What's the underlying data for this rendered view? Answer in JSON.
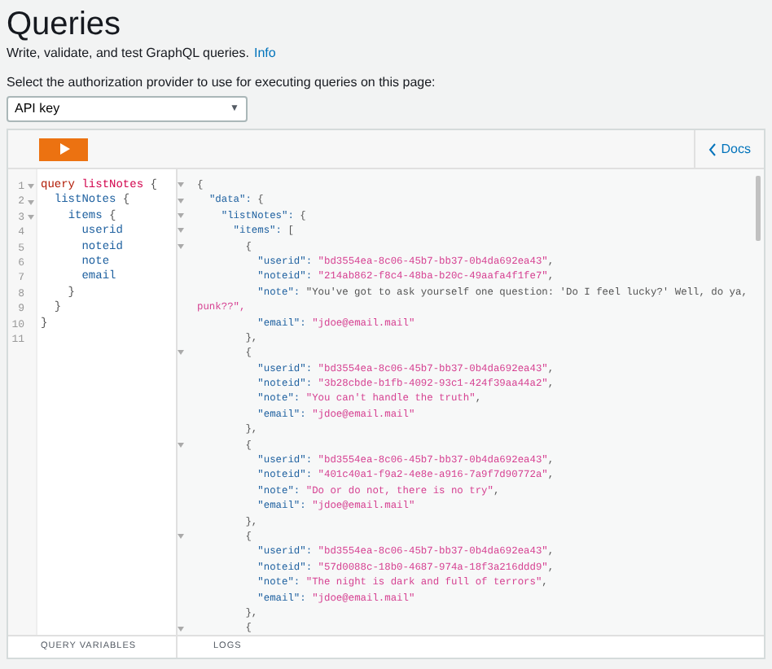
{
  "header": {
    "title": "Queries",
    "subtitle": "Write, validate, and test GraphQL queries.",
    "info_link": "Info",
    "auth_label": "Select the authorization provider to use for executing queries on this page:",
    "auth_select": {
      "value": "API key",
      "caret": "▼"
    }
  },
  "toolbar": {
    "docs": "Docs"
  },
  "query_editor": {
    "lines": [
      {
        "number": "1",
        "foldable": true,
        "text": "query listNotes {"
      },
      {
        "number": "2",
        "foldable": true,
        "text": "  listNotes {"
      },
      {
        "number": "3",
        "foldable": true,
        "text": "    items {"
      },
      {
        "number": "4",
        "foldable": false,
        "text": "      userid"
      },
      {
        "number": "5",
        "foldable": false,
        "text": "      noteid"
      },
      {
        "number": "6",
        "foldable": false,
        "text": "      note"
      },
      {
        "number": "7",
        "foldable": false,
        "text": "      email"
      },
      {
        "number": "8",
        "foldable": false,
        "text": "    }"
      },
      {
        "number": "9",
        "foldable": false,
        "text": "  }"
      },
      {
        "number": "10",
        "foldable": false,
        "text": "}"
      },
      {
        "number": "11",
        "foldable": false
      }
    ]
  },
  "results": {
    "lines": [
      {
        "foldable": true,
        "text": "{"
      },
      {
        "foldable": true,
        "text": "  \"data\": {"
      },
      {
        "foldable": true,
        "text": "    \"listNotes\": {"
      },
      {
        "foldable": true,
        "text": "      \"items\": ["
      },
      {
        "foldable": true,
        "text": "        {"
      },
      {
        "foldable": false,
        "text": "          \"userid\": \"bd3554ea-8c06-45b7-bb37-0b4da692ea43\","
      },
      {
        "foldable": false,
        "text": "          \"noteid\": \"214ab862-f8c4-48ba-b20c-49aafa4f1fe7\","
      },
      {
        "foldable": false,
        "text": "          \"note\": \"You've got to ask yourself one question: 'Do I feel lucky?' Well, do ya,"
      },
      {
        "foldable": false,
        "text": "punk??\","
      },
      {
        "foldable": false,
        "text": "          \"email\": \"jdoe@email.mail\""
      },
      {
        "foldable": false,
        "text": "        },"
      },
      {
        "foldable": true,
        "text": "        {"
      },
      {
        "foldable": false,
        "text": "          \"userid\": \"bd3554ea-8c06-45b7-bb37-0b4da692ea43\","
      },
      {
        "foldable": false,
        "text": "          \"noteid\": \"3b28cbde-b1fb-4092-93c1-424f39aa44a2\","
      },
      {
        "foldable": false,
        "text": "          \"note\": \"You can't handle the truth\","
      },
      {
        "foldable": false,
        "text": "          \"email\": \"jdoe@email.mail\""
      },
      {
        "foldable": false,
        "text": "        },"
      },
      {
        "foldable": true,
        "text": "        {"
      },
      {
        "foldable": false,
        "text": "          \"userid\": \"bd3554ea-8c06-45b7-bb37-0b4da692ea43\","
      },
      {
        "foldable": false,
        "text": "          \"noteid\": \"401c40a1-f9a2-4e8e-a916-7a9f7d90772a\","
      },
      {
        "foldable": false,
        "text": "          \"note\": \"Do or do not, there is no try\","
      },
      {
        "foldable": false,
        "text": "          \"email\": \"jdoe@email.mail\""
      },
      {
        "foldable": false,
        "text": "        },"
      },
      {
        "foldable": true,
        "text": "        {"
      },
      {
        "foldable": false,
        "text": "          \"userid\": \"bd3554ea-8c06-45b7-bb37-0b4da692ea43\","
      },
      {
        "foldable": false,
        "text": "          \"noteid\": \"57d0088c-18b0-4687-974a-18f3a216ddd9\","
      },
      {
        "foldable": false,
        "text": "          \"note\": \"The night is dark and full of terrors\","
      },
      {
        "foldable": false,
        "text": "          \"email\": \"jdoe@email.mail\""
      },
      {
        "foldable": false,
        "text": "        },"
      },
      {
        "foldable": true,
        "text": "        {"
      }
    ]
  },
  "footer": {
    "query_variables": "QUERY VARIABLES",
    "logs": "LOGS"
  }
}
